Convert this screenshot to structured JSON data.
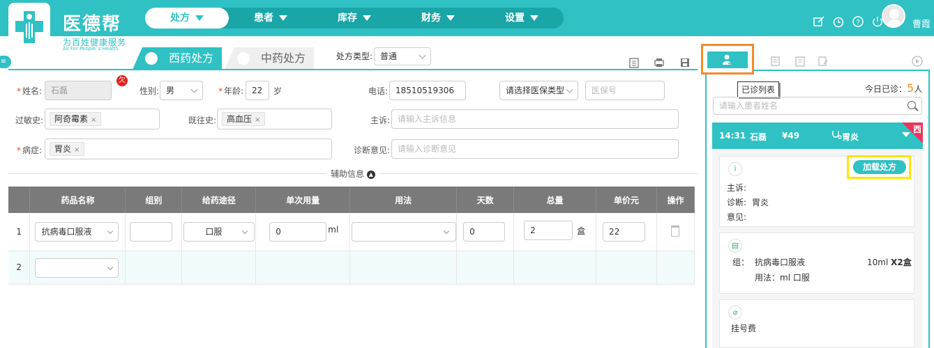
{
  "brand": {
    "name": "医德帮",
    "slogan": "为百姓健康服务",
    "slogan_en": "All For People`s Health"
  },
  "nav": [
    {
      "label": "处方",
      "active": true
    },
    {
      "label": "患者"
    },
    {
      "label": "库存"
    },
    {
      "label": "财务"
    },
    {
      "label": "设置"
    }
  ],
  "top_icons": [
    "edit-icon",
    "clock-icon",
    "help-icon",
    "power-icon"
  ],
  "user": {
    "name": "曹霞"
  },
  "tabs": {
    "western": "西药处方",
    "chinese": "中药处方"
  },
  "rx_type": {
    "label": "处方类型:",
    "value": "普通"
  },
  "form": {
    "name_label": "姓名:",
    "name_value": "石磊",
    "owe_badge": "欠",
    "gender_label": "性别:",
    "gender_value": "男",
    "age_label": "年龄:",
    "age_value": "22",
    "age_unit": "岁",
    "phone_label": "电话:",
    "phone_value": "18510519306",
    "insurance_type_placeholder": "请选择医保类型",
    "insurance_no_placeholder": "医保号",
    "allergy_label": "过敏史:",
    "allergy_tag": "阿奇霉素",
    "history_label": "既往史:",
    "history_tag": "高血压",
    "complaint_label": "主诉:",
    "complaint_placeholder": "请输入主诉信息",
    "disease_label": "病症:",
    "disease_tag": "胃炎",
    "diagnosis_label": "诊断意见:",
    "diagnosis_placeholder": "请输入诊断意见"
  },
  "aux_info": "辅助信息",
  "table": {
    "headers": [
      "药品名称",
      "组别",
      "给药途径",
      "单次用量",
      "用法",
      "天数",
      "总量",
      "单价元",
      "操作"
    ],
    "rows": [
      {
        "no": "1",
        "drug": "抗病毒口服液",
        "route": "口服",
        "dose": "0",
        "dose_unit": "ml",
        "days": "0",
        "total": "2",
        "total_unit": "盒",
        "price": "22"
      },
      {
        "no": "2"
      }
    ]
  },
  "right_panel": {
    "tooltip": "已诊列表",
    "today_label": "今日已诊：",
    "today_count": "5",
    "today_unit": "人",
    "search_placeholder": "请输入患者姓名",
    "record": {
      "time": "14:31",
      "name": "石磊",
      "fee": "¥49",
      "diagnosis": "胃炎",
      "corner": "西"
    },
    "load_button": "加载处方",
    "complaint_label": "主诉:",
    "diagnosis_label": "诊断:",
    "diagnosis_value": "胃炎",
    "opinion_label": "意见:",
    "group_label": "组：",
    "group_drug": "抗病毒口服液",
    "group_qty": "10ml",
    "group_times": "X2盒",
    "usage_text": "用法：ml  口服",
    "reg_fee": "挂号费"
  }
}
